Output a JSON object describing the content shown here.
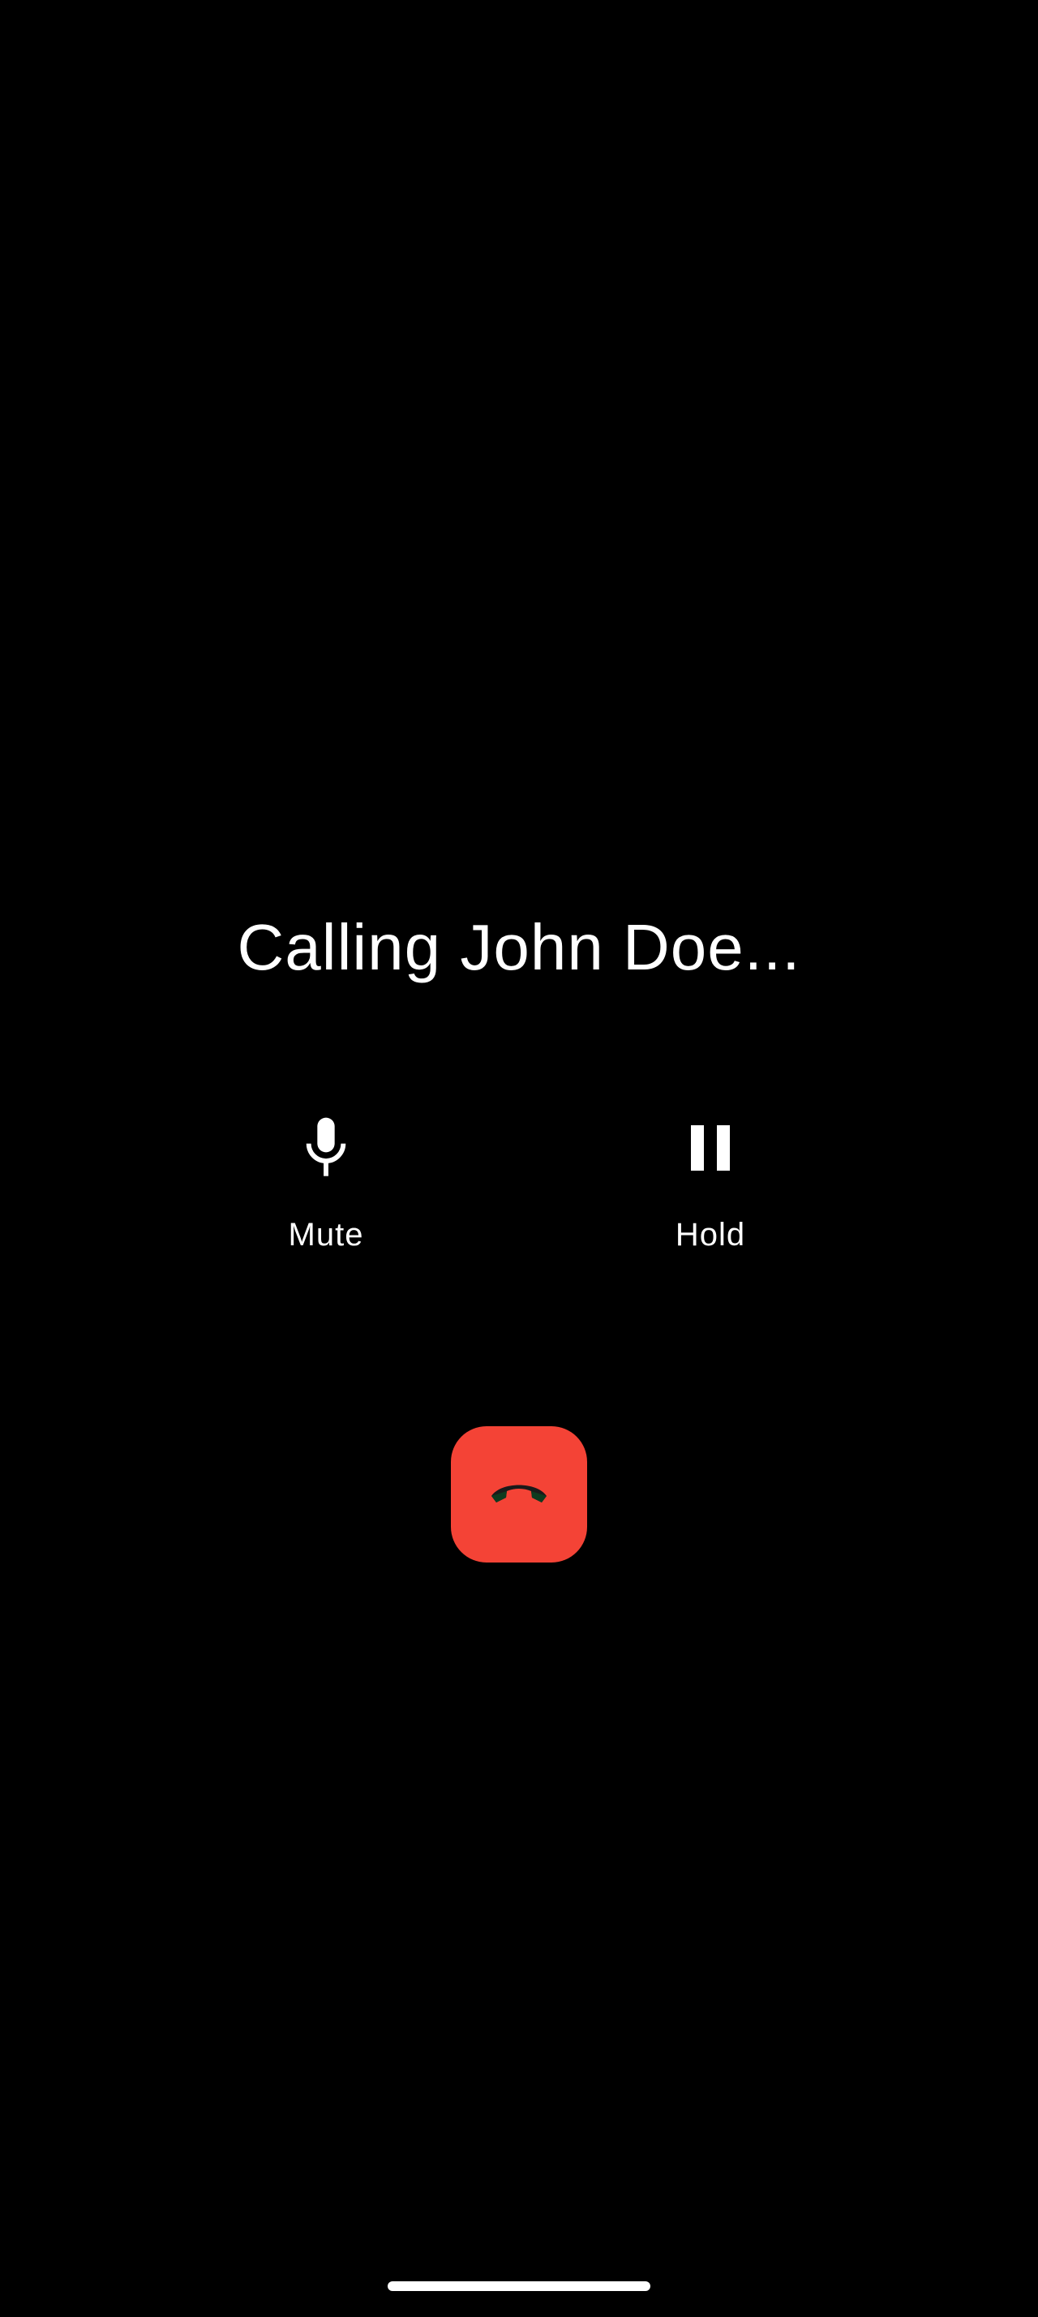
{
  "call": {
    "status_text": "Calling John Doe..."
  },
  "controls": {
    "mute": {
      "label": "Mute",
      "icon": "microphone-icon"
    },
    "hold": {
      "label": "Hold",
      "icon": "pause-icon"
    }
  },
  "end_call": {
    "icon": "hang-up-icon",
    "color": "#f44336"
  },
  "colors": {
    "background": "#000000",
    "text": "#ffffff",
    "end_call": "#f44336"
  }
}
